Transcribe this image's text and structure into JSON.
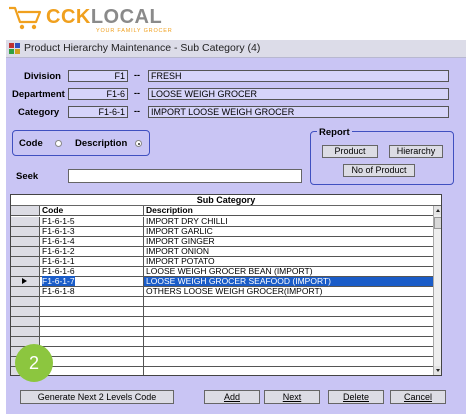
{
  "brand": {
    "main_a": "CCK",
    "main_b": "LOCAL",
    "tagline": "YOUR FAMILY GROCER"
  },
  "window": {
    "title": "Product Hierarchy Maintenance -  Sub Category (4)"
  },
  "fields": {
    "division": {
      "label": "Division",
      "code": "F1",
      "sep": "--",
      "name": "FRESH"
    },
    "department": {
      "label": "Department",
      "code": "F1-6",
      "sep": "--",
      "name": "LOOSE WEIGH GROCER"
    },
    "category": {
      "label": "Category",
      "code": "F1-6-1",
      "sep": "--",
      "name": "IMPORT LOOSE WEIGH GROCER"
    }
  },
  "sort": {
    "code_label": "Code",
    "description_label": "Description",
    "selected": "Description"
  },
  "report": {
    "title": "Report",
    "product": "Product",
    "hierarchy": "Hierarchy",
    "no_of_product": "No of Product"
  },
  "seek": {
    "label": "Seek",
    "value": ""
  },
  "grid": {
    "title": "Sub Category",
    "headers": {
      "code": "Code",
      "description": "Description"
    },
    "rows": [
      {
        "code": "F1-6-1-5",
        "description": "IMPORT DRY CHILLI"
      },
      {
        "code": "F1-6-1-3",
        "description": "IMPORT GARLIC"
      },
      {
        "code": "F1-6-1-4",
        "description": "IMPORT GINGER"
      },
      {
        "code": "F1-6-1-2",
        "description": "IMPORT ONION"
      },
      {
        "code": "F1-6-1-1",
        "description": "IMPORT POTATO"
      },
      {
        "code": "F1-6-1-6",
        "description": "LOOSE WEIGH GROCER BEAN (IMPORT)"
      },
      {
        "code": "F1-6-1-7",
        "description": "LOOSE WEIGH GROCER SEAFOOD (IMPORT)"
      },
      {
        "code": "F1-6-1-8",
        "description": "OTHERS LOOSE WEIGH GROCER(IMPORT)"
      }
    ],
    "selected_index": 6
  },
  "buttons": {
    "generate": "Generate Next 2 Levels Code",
    "add": "Add",
    "next": "Next",
    "delete": "Delete",
    "cancel": "Cancel"
  },
  "step_badge": "2",
  "colors": {
    "client_bg": "#c9c5f4",
    "selection": "#1a5cc8",
    "brand_orange": "#f0a01e",
    "badge_green": "#8cc63f"
  }
}
